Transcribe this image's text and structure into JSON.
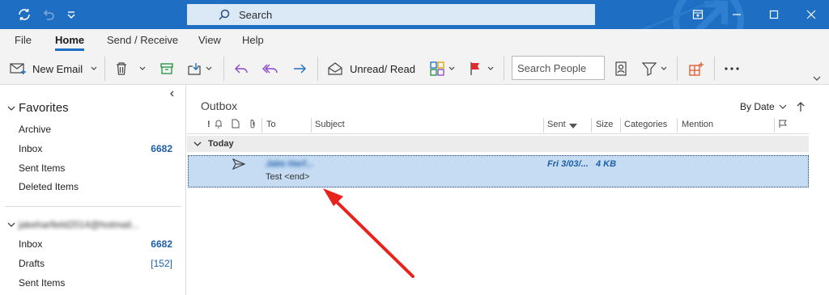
{
  "titlebar": {
    "search_label": "Search"
  },
  "tabs": [
    {
      "label": "File"
    },
    {
      "label": "Home"
    },
    {
      "label": "Send / Receive"
    },
    {
      "label": "View"
    },
    {
      "label": "Help"
    }
  ],
  "ribbon": {
    "new_email": "New Email",
    "unread_read": "Unread/ Read",
    "search_people_placeholder": "Search People"
  },
  "favorites": {
    "header": "Favorites",
    "items": [
      {
        "label": "Archive",
        "count": ""
      },
      {
        "label": "Inbox",
        "count": "6682"
      },
      {
        "label": "Sent Items",
        "count": ""
      },
      {
        "label": "Deleted Items",
        "count": ""
      }
    ]
  },
  "account": {
    "header": "jakeharfield2014@hotmail...",
    "items": [
      {
        "label": "Inbox",
        "count": "6682"
      },
      {
        "label": "Drafts",
        "count": "[152]"
      },
      {
        "label": "Sent Items",
        "count": ""
      }
    ]
  },
  "mail": {
    "folder_title": "Outbox",
    "sort_label": "By Date",
    "columns": {
      "importance": "!",
      "to": "To",
      "subject": "Subject",
      "sent": "Sent",
      "size": "Size",
      "categories": "Categories",
      "mention": "Mention"
    },
    "group": "Today",
    "message": {
      "to": "Jake Harf...",
      "subject": "Test <end>",
      "sent": "Fri 3/03/...",
      "size": "4 KB"
    }
  },
  "colors": {
    "accent": "#1e6fc3",
    "selection": "#c5dcf3",
    "annotation_arrow": "#e8221c"
  }
}
